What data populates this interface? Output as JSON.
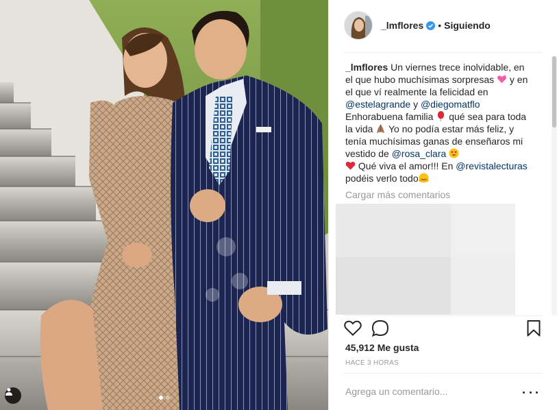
{
  "post": {
    "username": "_lmflores",
    "follow_status": "Siguiendo",
    "separator": "•",
    "caption": {
      "username": "_lmflores",
      "part1": "Un viernes trece inolvidable, en el que hubo muchísimas sorpresas",
      "part2": "y en el que ví realmente la felicidad en",
      "mention1": "@estelagrande",
      "part3": "y",
      "mention2": "@diegomatflo",
      "part4": "Enhorabuena familia",
      "part5": "qué sea para toda la vida",
      "part6": "Yo no podía estar más feliz, y tenía muchísimas ganas de enseñaros mi vestido de",
      "mention3": "@rosa_clara",
      "part7": "Qué viva el amor!!! En",
      "mention4": "@revistalecturas",
      "part8": "podéis verlo todo"
    },
    "load_more_comments": "Cargar más comentarios",
    "likes": "45,912 Me gusta",
    "timestamp": "HACE 3 HORAS",
    "add_comment_placeholder": "Agrega un comentario...",
    "carousel": {
      "total": 2,
      "active": 1
    }
  },
  "icons": {
    "verified": "verified-badge-icon",
    "like": "heart-icon",
    "comment": "comment-bubble-icon",
    "save": "bookmark-icon",
    "more": "more-options-icon",
    "tagged_user": "user-tag-icon"
  },
  "colors": {
    "text": "#262626",
    "secondary_text": "#999999",
    "mention": "#003569",
    "verified": "#3897f0",
    "border": "#efefef"
  }
}
